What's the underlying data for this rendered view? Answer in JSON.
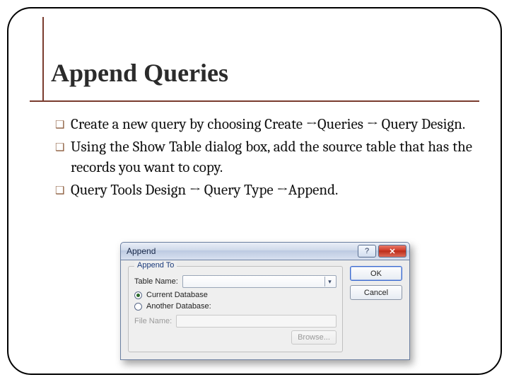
{
  "title": "Append Queries",
  "bullets": [
    "Create a new query by choosing Create →Queries → Query Design.",
    "Using the Show Table dialog box, add the source table that has the records you want to copy.",
    "Query Tools Design → Query Type →Append."
  ],
  "dialog": {
    "title": "Append",
    "help_symbol": "?",
    "close_symbol": "✕",
    "group_label": "Append To",
    "table_label": "Table Name:",
    "radio_current": "Current Database",
    "radio_another": "Another Database:",
    "file_label": "File Name:",
    "browse": "Browse...",
    "ok": "OK",
    "cancel": "Cancel"
  }
}
